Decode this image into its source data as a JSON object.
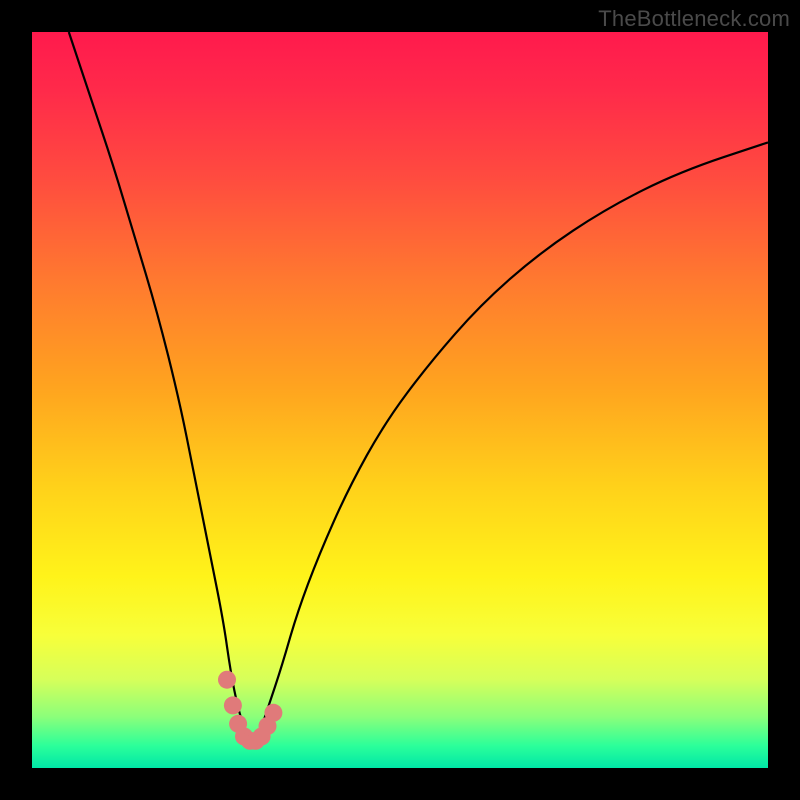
{
  "watermark": "TheBottleneck.com",
  "chart_data": {
    "type": "line",
    "title": "",
    "xlabel": "",
    "ylabel": "",
    "xlim": [
      0,
      100
    ],
    "ylim": [
      0,
      100
    ],
    "background_gradient": {
      "top": "#ff1a4d",
      "bottom": "#00e7a7",
      "meaning": "red = high bottleneck, green = low bottleneck"
    },
    "series": [
      {
        "name": "bottleneck-curve",
        "x": [
          5,
          8,
          11,
          14,
          17,
          20,
          22,
          24,
          26,
          27,
          28,
          29,
          30,
          31,
          32,
          34,
          36,
          39,
          43,
          48,
          54,
          61,
          69,
          78,
          88,
          100
        ],
        "y_percent_from_top": [
          0,
          9,
          18,
          28,
          38,
          50,
          60,
          70,
          80,
          87,
          92,
          95,
          96,
          95,
          92,
          86,
          79,
          71,
          62,
          53,
          45,
          37,
          30,
          24,
          19,
          15
        ]
      }
    ],
    "markers": {
      "name": "sweet-spot-dots",
      "color": "#e07a7a",
      "points": [
        {
          "x": 26.5,
          "y_percent_from_top": 88
        },
        {
          "x": 27.3,
          "y_percent_from_top": 91.5
        },
        {
          "x": 28.0,
          "y_percent_from_top": 94
        },
        {
          "x": 28.8,
          "y_percent_from_top": 95.7
        },
        {
          "x": 29.6,
          "y_percent_from_top": 96.3
        },
        {
          "x": 30.4,
          "y_percent_from_top": 96.3
        },
        {
          "x": 31.2,
          "y_percent_from_top": 95.7
        },
        {
          "x": 32.0,
          "y_percent_from_top": 94.3
        },
        {
          "x": 32.8,
          "y_percent_from_top": 92.5
        }
      ]
    }
  }
}
